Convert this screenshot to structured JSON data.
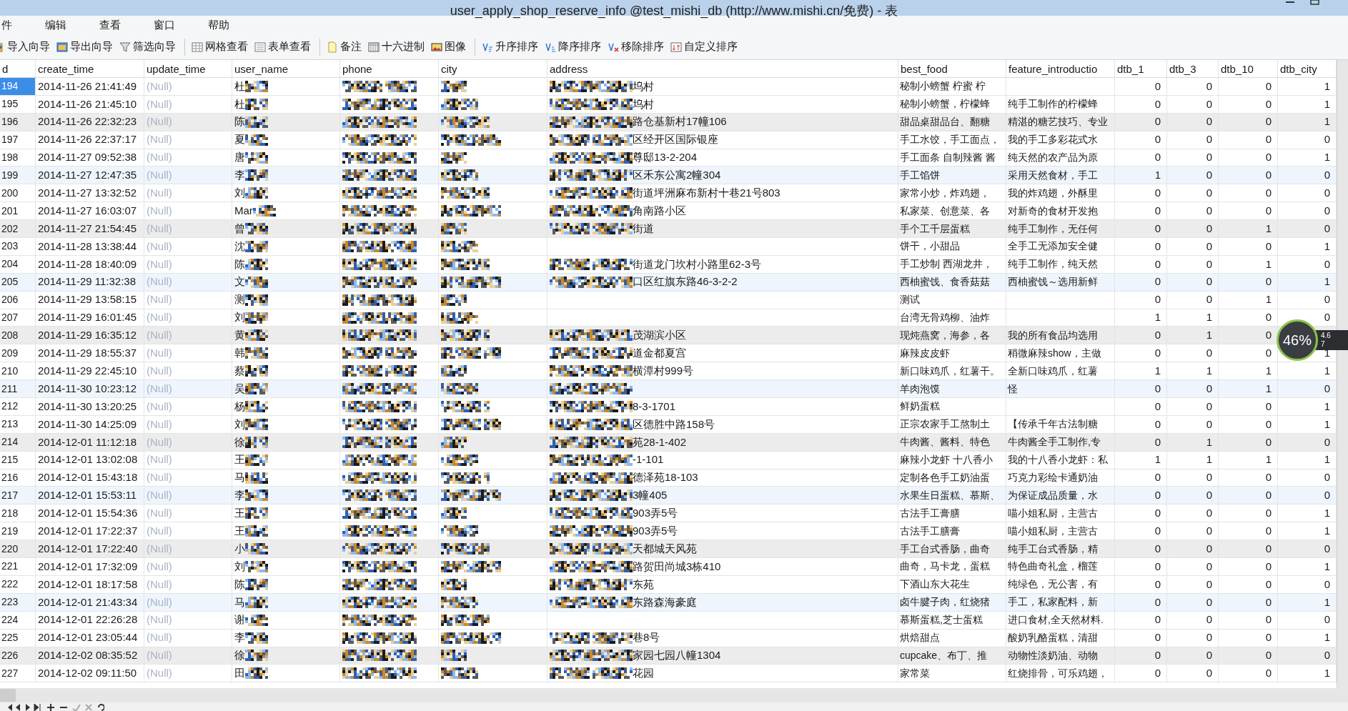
{
  "window": {
    "title": "user_apply_shop_reserve_info @test_mishi_db (http://www.mishi.cn/免费) - 表"
  },
  "menu": [
    "件",
    "编辑",
    "查看",
    "窗口",
    "帮助"
  ],
  "toolbar": {
    "groups": [
      [
        "导入向导",
        "导出向导",
        "筛选向导"
      ],
      [
        "网格查看",
        "表单查看"
      ],
      [
        "备注",
        "十六进制",
        "图像"
      ],
      [
        "升序排序",
        "降序排序",
        "移除排序",
        "自定义排序"
      ]
    ]
  },
  "table": {
    "columns": [
      "d",
      "create_time",
      "update_time",
      "user_name",
      "phone",
      "city",
      "address",
      "best_food",
      "feature_introductio",
      "dtb_1",
      "dtb_3",
      "dtb_10",
      "dtb_city"
    ],
    "rows": [
      {
        "id": "194",
        "create_time": "2014-11-26 21:41:49",
        "update_time": "(Null)",
        "user_name": "杜",
        "address_masked": true,
        "address": "坞村",
        "best_food": "秘制小螃蟹 柠蜜 柠",
        "dtb_1": "0",
        "dtb_3": "0",
        "dtb_10": "0",
        "dtb_city": "1",
        "selected": true
      },
      {
        "id": "195",
        "create_time": "2014-11-26 21:45:10",
        "update_time": "(Null)",
        "user_name": "杜",
        "address_masked": true,
        "address": "坞村",
        "best_food": "秘制小螃蟹，柠檬蜂",
        "feature": "纯手工制作的柠檬蜂",
        "dtb_1": "0",
        "dtb_3": "0",
        "dtb_10": "0",
        "dtb_city": "1",
        "selected": false
      },
      {
        "id": "196",
        "create_time": "2014-11-26 22:32:23",
        "update_time": "(Null)",
        "user_name": "陈",
        "address_masked": true,
        "address": "路仓基新村17幢106",
        "best_food": "甜品桌甜品台、翻糖",
        "feature": "精湛的糖艺技巧、专业",
        "dtb_1": "0",
        "dtb_3": "0",
        "dtb_10": "0",
        "dtb_city": "1",
        "selected": false
      },
      {
        "id": "197",
        "create_time": "2014-11-26 22:37:17",
        "update_time": "(Null)",
        "user_name": "夏",
        "address_masked": true,
        "address": "区经开区国际银座",
        "best_food": "手工水饺，手工面点，",
        "feature": "我的手工多彩花式水",
        "dtb_1": "0",
        "dtb_3": "0",
        "dtb_10": "0",
        "dtb_city": "0",
        "selected": false
      },
      {
        "id": "198",
        "create_time": "2014-11-27 09:52:38",
        "update_time": "(Null)",
        "user_name": "唐",
        "address_masked": true,
        "address": "尊邸13-2-204",
        "best_food": "手工面条 自制辣酱 酱",
        "feature": "纯天然的农产品为原",
        "dtb_1": "0",
        "dtb_3": "0",
        "dtb_10": "0",
        "dtb_city": "1",
        "selected": false
      },
      {
        "id": "199",
        "create_time": "2014-11-27 12:47:35",
        "update_time": "(Null)",
        "user_name": "李",
        "address_masked": true,
        "address": "区禾东公寓2幢304",
        "best_food": "手工馅饼",
        "feature": "采用天然食材，手工",
        "dtb_1": "1",
        "dtb_3": "0",
        "dtb_10": "0",
        "dtb_city": "0",
        "selected": false
      },
      {
        "id": "200",
        "create_time": "2014-11-27 13:32:52",
        "update_time": "(Null)",
        "user_name": "刘",
        "address_masked": true,
        "address": "街道坪洲麻布新村十巷21号803",
        "best_food": "家常小炒，炸鸡翅，",
        "feature": "我的炸鸡翅，外酥里",
        "dtb_1": "0",
        "dtb_3": "0",
        "dtb_10": "0",
        "dtb_city": "0",
        "selected": false
      },
      {
        "id": "201",
        "create_time": "2014-11-27 16:03:07",
        "update_time": "(Null)",
        "user_name": "Mar",
        "address_masked": true,
        "address": "角南路小区",
        "best_food": "私家菜、创意菜、各",
        "feature": "对新奇的食材开发抱",
        "dtb_1": "0",
        "dtb_3": "0",
        "dtb_10": "0",
        "dtb_city": "0",
        "selected": false
      },
      {
        "id": "202",
        "create_time": "2014-11-27 21:54:45",
        "update_time": "(Null)",
        "user_name": "曾",
        "address_masked": true,
        "address": "街道",
        "best_food": "手个工千层蛋糕",
        "feature": "纯手工制作，无任何",
        "dtb_1": "0",
        "dtb_3": "0",
        "dtb_10": "1",
        "dtb_city": "0",
        "selected": false
      },
      {
        "id": "203",
        "create_time": "2014-11-28 13:38:44",
        "update_time": "(Null)",
        "user_name": "沈",
        "address_masked": false,
        "best_food": "饼干，小甜品",
        "feature": "全手工无添加安全健",
        "dtb_1": "0",
        "dtb_3": "0",
        "dtb_10": "0",
        "dtb_city": "1",
        "selected": false
      },
      {
        "id": "204",
        "create_time": "2014-11-28 18:40:09",
        "update_time": "(Null)",
        "user_name": "陈",
        "address_masked": true,
        "address": "街道龙门坎村小路里62-3号",
        "best_food": "手工炒制 西湖龙井，",
        "feature": "纯手工制作，纯天然",
        "dtb_1": "0",
        "dtb_3": "0",
        "dtb_10": "1",
        "dtb_city": "0",
        "selected": false
      },
      {
        "id": "205",
        "create_time": "2014-11-29 11:32:38",
        "update_time": "(Null)",
        "user_name": "文",
        "address_masked": true,
        "address": "口区红旗东路46-3-2-2",
        "best_food": "西柚蜜饯、食香菇菇",
        "feature": "西柚蜜饯～选用新鲜",
        "dtb_1": "0",
        "dtb_3": "0",
        "dtb_10": "0",
        "dtb_city": "1",
        "selected": false
      },
      {
        "id": "206",
        "create_time": "2014-11-29 13:58:15",
        "update_time": "(Null)",
        "user_name": "测",
        "address_masked": false,
        "best_food": "测试",
        "dtb_1": "0",
        "dtb_3": "0",
        "dtb_10": "1",
        "dtb_city": "0",
        "selected": false
      },
      {
        "id": "207",
        "create_time": "2014-11-29 16:01:45",
        "update_time": "(Null)",
        "user_name": "刘",
        "address_masked": false,
        "best_food": "台湾无骨鸡柳、油炸",
        "dtb_1": "1",
        "dtb_3": "1",
        "dtb_10": "0",
        "dtb_city": "0",
        "selected": false
      },
      {
        "id": "208",
        "create_time": "2014-11-29 16:35:12",
        "update_time": "(Null)",
        "user_name": "黄",
        "address_masked": true,
        "address": "茂湖滨小区",
        "best_food": "现炖燕窝，海参，各",
        "feature": "我的所有食品均选用",
        "dtb_1": "0",
        "dtb_3": "1",
        "dtb_10": "0",
        "selected": false
      },
      {
        "id": "209",
        "create_time": "2014-11-29 18:55:37",
        "update_time": "(Null)",
        "user_name": "韩",
        "address_masked": true,
        "address": "道金都夏宫",
        "best_food": "麻辣皮皮虾",
        "feature": "稍微麻辣show，主做",
        "dtb_1": "0",
        "dtb_3": "0",
        "dtb_10": "0",
        "dtb_city": "1",
        "selected": false
      },
      {
        "id": "210",
        "create_time": "2014-11-29 22:45:10",
        "update_time": "(Null)",
        "user_name": "蔡",
        "address_masked": true,
        "address": "横潭村999号",
        "best_food": "新口味鸡爪，红薯干。",
        "feature": "全新口味鸡爪，红薯",
        "dtb_1": "1",
        "dtb_3": "1",
        "dtb_10": "1",
        "dtb_city": "1",
        "selected": false
      },
      {
        "id": "211",
        "create_time": "2014-11-30 10:23:12",
        "update_time": "(Null)",
        "user_name": "吴",
        "address_masked": true,
        "best_food": "羊肉泡馍",
        "feature": "怪",
        "dtb_1": "0",
        "dtb_3": "0",
        "dtb_10": "1",
        "dtb_city": "0",
        "selected": false
      },
      {
        "id": "212",
        "create_time": "2014-11-30 13:20:25",
        "update_time": "(Null)",
        "user_name": "杨",
        "address_masked": true,
        "address": "8-3-1701",
        "best_food": "鲜奶蛋糕",
        "dtb_1": "0",
        "dtb_3": "0",
        "dtb_10": "0",
        "dtb_city": "1",
        "selected": false
      },
      {
        "id": "213",
        "create_time": "2014-11-30 14:25:09",
        "update_time": "(Null)",
        "user_name": "刘",
        "address_masked": true,
        "address": "区德胜中路158号",
        "best_food": "正宗农家手工熬制土",
        "feature": "【传承千年古法制糖",
        "dtb_1": "0",
        "dtb_3": "0",
        "dtb_10": "0",
        "dtb_city": "1",
        "selected": false
      },
      {
        "id": "214",
        "create_time": "2014-12-01 11:12:18",
        "update_time": "(Null)",
        "user_name": "徐",
        "address_masked": true,
        "address": "苑28-1-402",
        "best_food": "牛肉酱、酱料、特色",
        "feature": "牛肉酱全手工制作,专",
        "dtb_1": "0",
        "dtb_3": "1",
        "dtb_10": "0",
        "dtb_city": "0",
        "selected": false
      },
      {
        "id": "215",
        "create_time": "2014-12-01 13:02:08",
        "update_time": "(Null)",
        "user_name": "王",
        "address_masked": true,
        "address": "-1-101",
        "best_food": "麻辣小龙虾 十八香小",
        "feature": "我的十八香小龙虾：私",
        "dtb_1": "1",
        "dtb_3": "1",
        "dtb_10": "1",
        "dtb_city": "1",
        "selected": false
      },
      {
        "id": "216",
        "create_time": "2014-12-01 15:43:18",
        "update_time": "(Null)",
        "user_name": "马",
        "address_masked": true,
        "address": "德泽苑18-103",
        "best_food": "定制各色手工奶油蛋",
        "feature": "巧克力彩绘卡通奶油",
        "dtb_1": "0",
        "dtb_3": "0",
        "dtb_10": "0",
        "dtb_city": "0",
        "selected": false
      },
      {
        "id": "217",
        "create_time": "2014-12-01 15:53:11",
        "update_time": "(Null)",
        "user_name": "李",
        "address_masked": true,
        "address": "3幢405",
        "best_food": "水果生日蛋糕、慕斯、",
        "feature": "为保证成品质量，水",
        "dtb_1": "0",
        "dtb_3": "0",
        "dtb_10": "0",
        "dtb_city": "0",
        "selected": false
      },
      {
        "id": "218",
        "create_time": "2014-12-01 15:54:36",
        "update_time": "(Null)",
        "user_name": "王",
        "address_masked": true,
        "address": "903弄5号",
        "best_food": "古法手工膏膳",
        "feature": "喵小姐私厨，主营古",
        "dtb_1": "0",
        "dtb_3": "0",
        "dtb_10": "0",
        "dtb_city": "1",
        "selected": false
      },
      {
        "id": "219",
        "create_time": "2014-12-01 17:22:37",
        "update_time": "(Null)",
        "user_name": "王",
        "address_masked": true,
        "address": "903弄5号",
        "best_food": "古法手工膳膏",
        "feature": "喵小姐私厨，主营古",
        "dtb_1": "0",
        "dtb_3": "0",
        "dtb_10": "0",
        "dtb_city": "1",
        "selected": false
      },
      {
        "id": "220",
        "create_time": "2014-12-01 17:22:40",
        "update_time": "(Null)",
        "user_name": "小",
        "address_masked": true,
        "address": "天都城天风苑",
        "best_food": "手工台式香肠，曲奇",
        "feature": "纯手工台式香肠，精",
        "dtb_1": "0",
        "dtb_3": "0",
        "dtb_10": "0",
        "dtb_city": "0",
        "selected": false
      },
      {
        "id": "221",
        "create_time": "2014-12-01 17:32:09",
        "update_time": "(Null)",
        "user_name": "刘",
        "address_masked": true,
        "address": "路贺田尚城3栋410",
        "best_food": "曲奇，马卡龙，蛋糕",
        "feature": "特色曲奇礼盒，榴莲",
        "dtb_1": "0",
        "dtb_3": "0",
        "dtb_10": "0",
        "dtb_city": "1",
        "selected": false
      },
      {
        "id": "222",
        "create_time": "2014-12-01 18:17:58",
        "update_time": "(Null)",
        "user_name": "陈",
        "address_masked": true,
        "address": "东苑",
        "best_food": "下酒山东大花生",
        "feature": "纯绿色，无公害，有",
        "dtb_1": "0",
        "dtb_3": "0",
        "dtb_10": "0",
        "dtb_city": "0",
        "selected": false
      },
      {
        "id": "223",
        "create_time": "2014-12-01 21:43:34",
        "update_time": "(Null)",
        "user_name": "马",
        "address_masked": true,
        "address": "东路森海豪庭",
        "best_food": "卤牛腱子肉，红烧猪",
        "feature": "手工，私家配料，新",
        "dtb_1": "0",
        "dtb_3": "0",
        "dtb_10": "0",
        "dtb_city": "1",
        "selected": false
      },
      {
        "id": "224",
        "create_time": "2014-12-01 22:26:28",
        "update_time": "(Null)",
        "user_name": "谢",
        "address_masked": false,
        "best_food": "慕斯蛋糕,芝士蛋糕",
        "feature": "进口食材,全天然材料.",
        "dtb_1": "0",
        "dtb_3": "0",
        "dtb_10": "0",
        "dtb_city": "0",
        "selected": false
      },
      {
        "id": "225",
        "create_time": "2014-12-01 23:05:44",
        "update_time": "(Null)",
        "user_name": "李",
        "address_masked": true,
        "address": "巷8号",
        "best_food": "烘焙甜点",
        "feature": "酸奶乳酪蛋糕，清甜",
        "dtb_1": "0",
        "dtb_3": "0",
        "dtb_10": "0",
        "dtb_city": "1",
        "selected": false
      },
      {
        "id": "226",
        "create_time": "2014-12-02 08:35:52",
        "update_time": "(Null)",
        "user_name": "徐",
        "address_masked": true,
        "address": "家园七园八幢1304",
        "best_food": "cupcake、布丁、推",
        "feature": "动物性淡奶油、动物",
        "dtb_1": "0",
        "dtb_3": "0",
        "dtb_10": "0",
        "dtb_city": "0",
        "selected": false
      },
      {
        "id": "227",
        "create_time": "2014-12-02 09:11:50",
        "update_time": "(Null)",
        "user_name": "田",
        "address_masked": true,
        "address": "花园",
        "best_food": "家常菜",
        "feature": "红烧排骨，可乐鸡翅，",
        "dtb_1": "0",
        "dtb_3": "0",
        "dtb_10": "0",
        "dtb_city": "1",
        "selected": false
      }
    ]
  },
  "monitor_widget": {
    "percent": "46%",
    "upload": "4.6",
    "download": "7"
  }
}
